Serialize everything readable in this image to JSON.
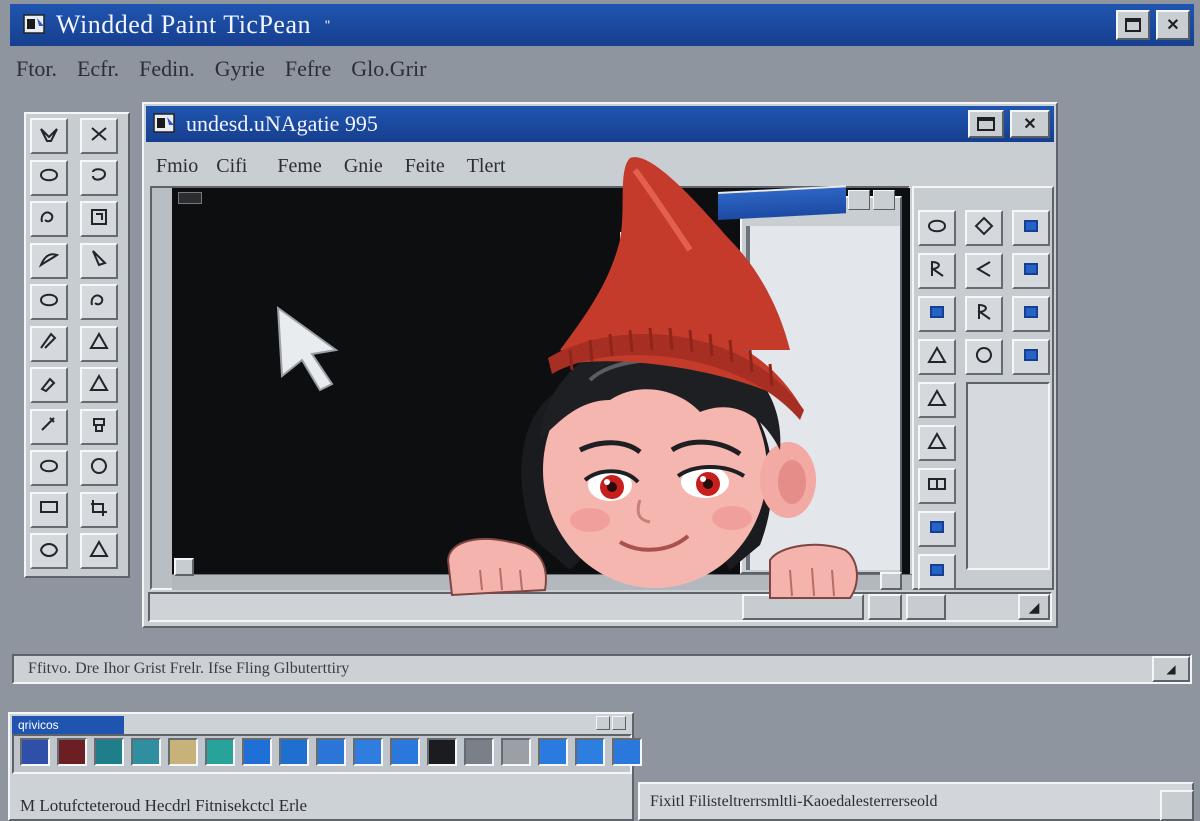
{
  "outer_window": {
    "title": "Windded Paint TicPean",
    "menu": [
      "Ftor.",
      "Ecfr.",
      "Fedin.",
      "Gyrie",
      "Fefre",
      "Glo.Grir"
    ]
  },
  "inner_window": {
    "title": "undesd.uNAgatie 995",
    "menu": [
      "Fmio",
      "Cifi",
      "Feme",
      "Gnie",
      "Feite",
      "Tlert"
    ]
  },
  "back_window": {
    "title": ""
  },
  "left_tools": [
    "select-tool",
    "eraser-tool",
    "lasso-tool",
    "fill-tool",
    "curve-tool",
    "frame-tool",
    "brush-tool",
    "smudge-tool",
    "ellipse-tool",
    "loop-tool",
    "pen-tool",
    "triangle-tool",
    "picker-tool",
    "triangle-tool",
    "pencil-tool",
    "stamp-tool",
    "oval-tool",
    "circle-tool",
    "rectangle-tool",
    "crop-tool",
    "rounded-shape-tool",
    "triangle-tool"
  ],
  "right_tools": [
    "ellipse-tool",
    "diamond-tool",
    "blue-fill-tool",
    "r-curve-tool",
    "angle-tool",
    "blue-fill-tool",
    "blue-card-tool",
    "r-curve-tool",
    "blue-fill-tool",
    "triangle-tool",
    "circle-tool",
    "blue-fill-tool",
    "triangle-tool",
    "triangle-tool",
    "split-rect-tool",
    "blue-chip-tool",
    "blue-chip-tool"
  ],
  "status_bar": {
    "text": "Ffitvo. Dre Ihor Grist Frelr. Ifse Fling Glbuterttiry"
  },
  "palette_window": {
    "title": "qrivicos",
    "colors": [
      "#2f4fa8",
      "#6b1f22",
      "#1e7e89",
      "#2f8fa0",
      "#c7b27a",
      "#27a39a",
      "#1e6fd6",
      "#1f6fd1",
      "#2b74d8",
      "#2e7ddf",
      "#2a78dc",
      "#1b1c1f",
      "#7a8087",
      "#9aa0a6",
      "#2a7bdf",
      "#2c7fe0",
      "#2b78dd"
    ]
  },
  "bottom_left_text": "M Lotufcteteroud Hecdrl Fitnisekctcl Erle",
  "bottom_right_text": "Fixitl Filisteltrerrsmltli-Kaoedalesterrerseold"
}
